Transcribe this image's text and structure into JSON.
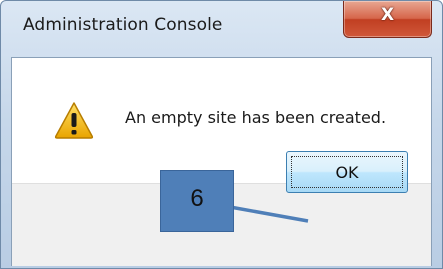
{
  "window": {
    "title": "Administration Console",
    "close_label": "X"
  },
  "dialog": {
    "icon": "warning-icon",
    "message": "An empty site has been created.",
    "ok_label": "OK"
  },
  "annotation": {
    "callout_number": "6",
    "callout_color": "#4f7fb8"
  }
}
